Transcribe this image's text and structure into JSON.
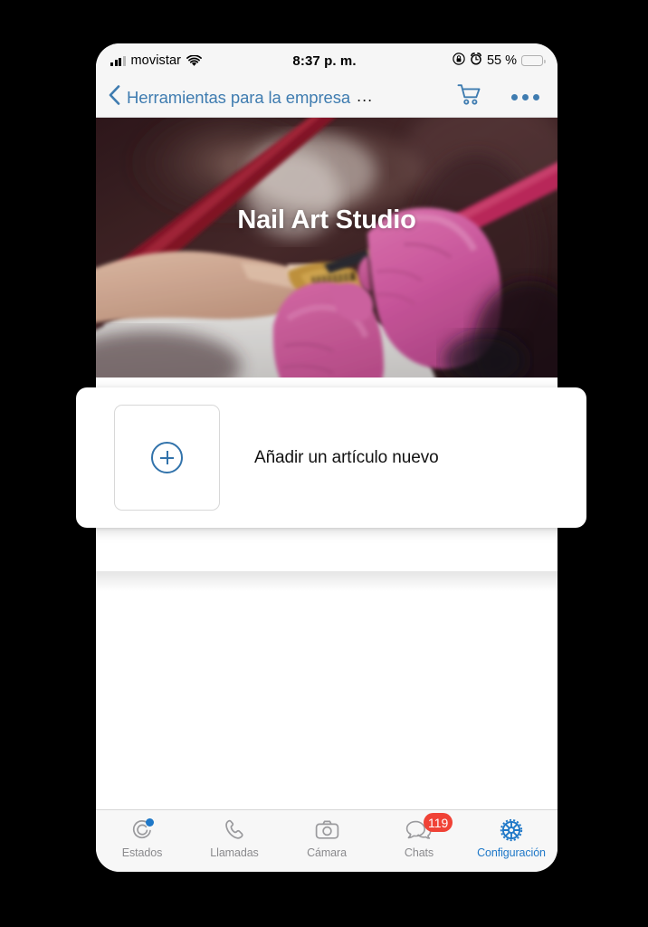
{
  "statusbar": {
    "carrier": "movistar",
    "time": "8:37 p. m.",
    "battery_percent": "55 %",
    "battery_level": 55,
    "signal_bars_filled": 3,
    "signal_bars_total": 4,
    "icons": [
      "signal-bars-icon",
      "wifi-icon",
      "rotation-lock-icon",
      "alarm-clock-icon",
      "battery-icon"
    ]
  },
  "navbar": {
    "back_label": "Herramientas para la empresa",
    "title_truncation": "...",
    "cart_icon": "shopping-cart-icon",
    "more_icon": "more-options-icon",
    "accent_color": "#3f7cb0"
  },
  "hero": {
    "title": "Nail Art Studio",
    "image_description": "nail-salon-manicure-photo"
  },
  "card": {
    "label": "Añadir un artículo nuevo",
    "thumb_icon": "plus-circle-icon",
    "accent_color": "#3273ab"
  },
  "tabbar": {
    "items": [
      {
        "label": "Estados",
        "icon": "status-ring-icon",
        "active": false,
        "dot": true
      },
      {
        "label": "Llamadas",
        "icon": "phone-handset-icon",
        "active": false
      },
      {
        "label": "Cámara",
        "icon": "camera-icon",
        "active": false
      },
      {
        "label": "Chats",
        "icon": "chat-bubbles-icon",
        "active": false,
        "badge": "119"
      },
      {
        "label": "Configuración",
        "icon": "gear-icon",
        "active": true
      }
    ],
    "active_color": "#1f78c8",
    "inactive_color": "#8a8a8d",
    "badge_color": "#f04236"
  }
}
